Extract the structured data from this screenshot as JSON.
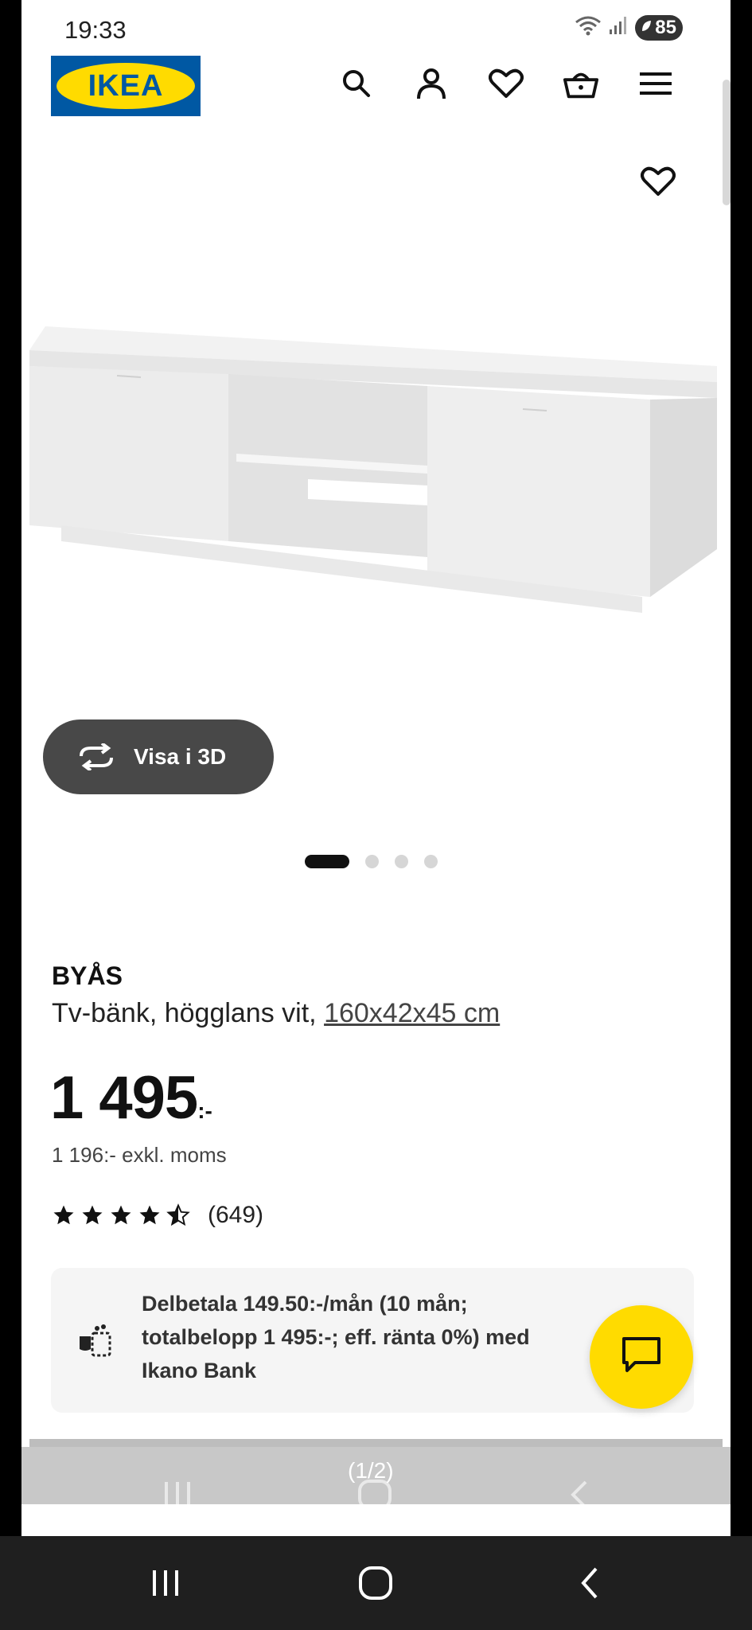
{
  "status_bar": {
    "time": "19:33",
    "battery": "85"
  },
  "header": {
    "logo_text": "IKEA",
    "icons": [
      "search-icon",
      "user-icon",
      "heart-icon",
      "basket-icon",
      "menu-icon"
    ]
  },
  "gallery": {
    "view_3d_label": "Visa i 3D",
    "image_count": 4,
    "active_index": 0
  },
  "product": {
    "name": "BYÅS",
    "description_prefix": "Tv-bänk, högglans vit, ",
    "dimensions": "160x42x45 cm",
    "price": "1 495",
    "price_suffix": ":-",
    "price_excl_vat": "1 196:- exkl. moms",
    "rating": 4.5,
    "review_count": "(649)"
  },
  "financing": {
    "text": "Delbetala 149.50:-/mån (10 mån; totalbelopp 1 495:-; eff. ränta 0%) med Ikano Bank"
  },
  "overlay": {
    "page_counter": "(1/2)"
  },
  "colors": {
    "brand_blue": "#0058a3",
    "brand_yellow": "#ffdb00",
    "button_dark": "#484848"
  }
}
